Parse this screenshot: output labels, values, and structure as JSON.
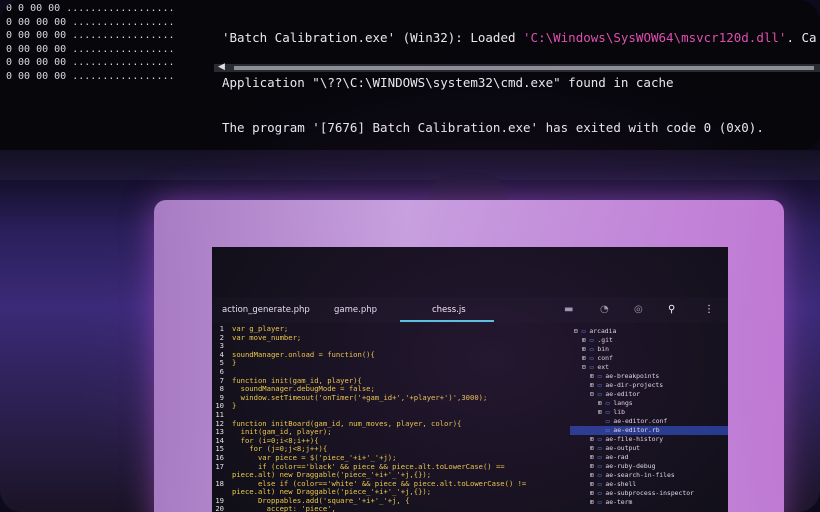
{
  "monitor": {
    "dots_lines": [
      "0 0 00 00 ..................",
      "0 00 00 00 .................",
      "0 00 00 00 .................",
      "0 00 00 00 .................",
      "0 00 00 00 .................",
      "0 00 00 00 ................."
    ],
    "log_line_1_a": "'Batch Calibration.exe' (Win32): Loaded ",
    "log_line_1_b": "'C:\\Windows\\SysWOW64\\msvcr120d.dll'",
    "log_line_1_c": ". Ca",
    "log_line_2": "Application \"\\??\\C:\\WINDOWS\\system32\\cmd.exe\" found in cache",
    "log_line_3": "The program '[7676] Batch Calibration.exe' has exited with code 0 (0x0)."
  },
  "editor": {
    "tabs": [
      "action_generate.php",
      "game.php",
      "chess.js"
    ],
    "active_tab": "chess.js",
    "toolbar_icons": [
      "android-icon",
      "history-icon",
      "check-circle-icon",
      "search-icon",
      "more-vert-icon"
    ],
    "code_lines": [
      {
        "n": "1",
        "t": "var g_player;"
      },
      {
        "n": "2",
        "t": "var move_number;"
      },
      {
        "n": "3",
        "t": ""
      },
      {
        "n": "4",
        "t": "soundManager.onload = function(){"
      },
      {
        "n": "5",
        "t": "}"
      },
      {
        "n": "6",
        "t": ""
      },
      {
        "n": "7",
        "t": "function init(gam_id, player){"
      },
      {
        "n": "8",
        "t": "  soundManager.debugMode = false;"
      },
      {
        "n": "9",
        "t": "  window.setTimeout('onTimer('+gam_id+','+player+')',3000);"
      },
      {
        "n": "10",
        "t": "}"
      },
      {
        "n": "11",
        "t": ""
      },
      {
        "n": "12",
        "t": "function initBoard(gam_id, num_moves, player, color){"
      },
      {
        "n": "13",
        "t": "  init(gam_id, player);"
      },
      {
        "n": "14",
        "t": "  for (i=0;i<8;i++){"
      },
      {
        "n": "15",
        "t": "    for (j=0;j<8;j++){"
      },
      {
        "n": "16",
        "t": "      var piece = $('piece_'+i+'_'+j);"
      },
      {
        "n": "17",
        "t": "      if (color=='black' && piece && piece.alt.toLowerCase() =="
      },
      {
        "n": "",
        "t": "piece.alt) new Draggable('piece_'+i+'_'+j,{});"
      },
      {
        "n": "18",
        "t": "      else if (color=='white' && piece && piece.alt.toLowerCase() !="
      },
      {
        "n": "",
        "t": "piece.alt) new Draggable('piece_'+i+'_'+j,{});"
      },
      {
        "n": "19",
        "t": "      Droppables.add('square_'+i+'_'+j, {"
      },
      {
        "n": "20",
        "t": "        accept: 'piece',"
      }
    ],
    "tree": [
      {
        "label": "arcadia",
        "indent": 0,
        "mark": "⊟"
      },
      {
        "label": ".git",
        "indent": 1,
        "mark": "⊞"
      },
      {
        "label": "bin",
        "indent": 1,
        "mark": "⊞"
      },
      {
        "label": "conf",
        "indent": 1,
        "mark": "⊞"
      },
      {
        "label": "ext",
        "indent": 1,
        "mark": "⊟"
      },
      {
        "label": "ae-breakpoints",
        "indent": 2,
        "mark": "⊞"
      },
      {
        "label": "ae-dir-projects",
        "indent": 2,
        "mark": "⊞"
      },
      {
        "label": "ae-editor",
        "indent": 2,
        "mark": "⊟"
      },
      {
        "label": "langs",
        "indent": 3,
        "mark": "⊞"
      },
      {
        "label": "lib",
        "indent": 3,
        "mark": "⊞"
      },
      {
        "label": "ae-editor.conf",
        "indent": 3,
        "mark": " "
      },
      {
        "label": "ae-editor.rb",
        "indent": 3,
        "mark": " ",
        "selected": true
      },
      {
        "label": "ae-file-history",
        "indent": 2,
        "mark": "⊞"
      },
      {
        "label": "ae-output",
        "indent": 2,
        "mark": "⊞"
      },
      {
        "label": "ae-rad",
        "indent": 2,
        "mark": "⊞"
      },
      {
        "label": "ae-ruby-debug",
        "indent": 2,
        "mark": "⊞"
      },
      {
        "label": "ae-search-in-files",
        "indent": 2,
        "mark": "⊞"
      },
      {
        "label": "ae-shell",
        "indent": 2,
        "mark": "⊞"
      },
      {
        "label": "ae-subprocess-inspector",
        "indent": 2,
        "mark": "⊞"
      },
      {
        "label": "ae-term",
        "indent": 2,
        "mark": "⊞"
      }
    ]
  }
}
